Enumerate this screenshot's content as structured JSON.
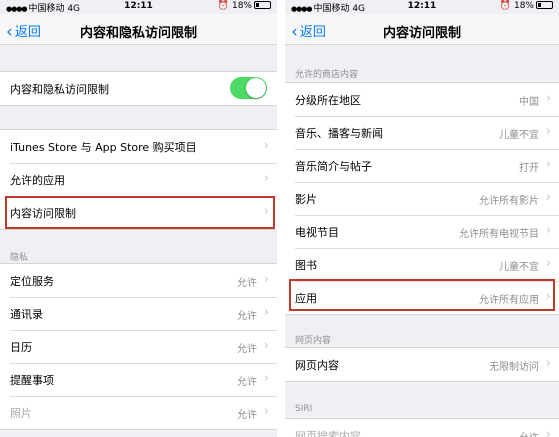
{
  "left": {
    "status": {
      "carrier": "中国移动",
      "network": "4G",
      "time": "12:11",
      "battery": "18%"
    },
    "nav": {
      "back": "返回",
      "title": "内容和隐私访问限制"
    },
    "toggle_row": {
      "label": "内容和隐私访问限制",
      "on": true
    },
    "group1": [
      {
        "label": "iTunes Store 与 App Store 购买项目"
      },
      {
        "label": "允许的应用"
      },
      {
        "label": "内容访问限制"
      }
    ],
    "privacy_header": "隐私",
    "privacy": [
      {
        "label": "定位服务",
        "value": "允许"
      },
      {
        "label": "通讯录",
        "value": "允许"
      },
      {
        "label": "日历",
        "value": "允许"
      },
      {
        "label": "提醒事项",
        "value": "允许"
      },
      {
        "label": "照片",
        "value": "允许"
      }
    ]
  },
  "right": {
    "status": {
      "carrier": "中国移动",
      "network": "4G",
      "time": "12:11",
      "battery": "18%"
    },
    "nav": {
      "back": "返回",
      "title": "内容访问限制"
    },
    "store_header": "允许的商店内容",
    "store": [
      {
        "label": "分级所在地区",
        "value": "中国"
      },
      {
        "label": "音乐、播客与新闻",
        "value": "儿童不宜"
      },
      {
        "label": "音乐简介与帖子",
        "value": "打开"
      },
      {
        "label": "影片",
        "value": "允许所有影片"
      },
      {
        "label": "电视节目",
        "value": "允许所有电视节目"
      },
      {
        "label": "图书",
        "value": "儿童不宜"
      },
      {
        "label": "应用",
        "value": "允许所有应用"
      }
    ],
    "web_header": "网页内容",
    "web": [
      {
        "label": "网页内容",
        "value": "无限制访问"
      }
    ],
    "siri_header": "SIRI",
    "siri": [
      {
        "label": "网页搜索内容",
        "value": "允许"
      }
    ]
  },
  "colors": {
    "accent": "#007aff",
    "toggle_on": "#4cd964",
    "highlight": "#c0392b"
  },
  "icons": {
    "chevron": "chevron-right-icon",
    "back": "chevron-left-icon"
  }
}
